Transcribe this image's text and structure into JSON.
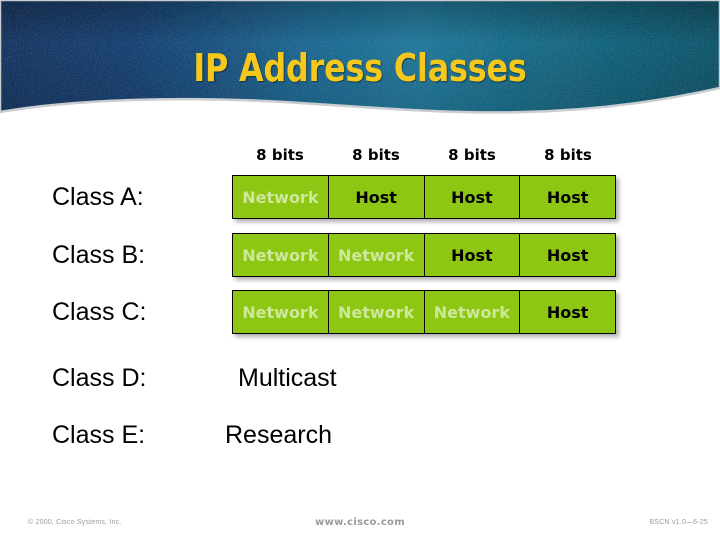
{
  "header": {
    "title": "IP Address Classes",
    "title_color": "#f7c81c",
    "gradient_left": "#153d70",
    "gradient_mid": "#1f6f96",
    "gradient_right": "#0e6f86"
  },
  "main": {
    "bits_headers": [
      "8 bits",
      "8 bits",
      "8 bits",
      "8 bits"
    ],
    "cell_color": "#8ec713",
    "network_text_color": "#cde89a",
    "host_text_color": "#000000",
    "rows": [
      {
        "label": "Class A:",
        "type": "octets",
        "cells": [
          {
            "text": "Network",
            "kind": "network"
          },
          {
            "text": "Host",
            "kind": "host"
          },
          {
            "text": "Host",
            "kind": "host"
          },
          {
            "text": "Host",
            "kind": "host"
          }
        ]
      },
      {
        "label": "Class B:",
        "type": "octets",
        "cells": [
          {
            "text": "Network",
            "kind": "network"
          },
          {
            "text": "Network",
            "kind": "network"
          },
          {
            "text": "Host",
            "kind": "host"
          },
          {
            "text": "Host",
            "kind": "host"
          }
        ]
      },
      {
        "label": "Class C:",
        "type": "octets",
        "cells": [
          {
            "text": "Network",
            "kind": "network"
          },
          {
            "text": "Network",
            "kind": "network"
          },
          {
            "text": "Network",
            "kind": "network"
          },
          {
            "text": "Host",
            "kind": "host"
          }
        ]
      },
      {
        "label": "Class D:",
        "type": "text",
        "value": "Multicast"
      },
      {
        "label": "Class E:",
        "type": "text",
        "value": "Research"
      }
    ]
  },
  "footer": {
    "copyright": "© 2000, Cisco Systems, Inc.",
    "url": "www.cisco.com",
    "code": "BSCN v1.0—6-25"
  }
}
